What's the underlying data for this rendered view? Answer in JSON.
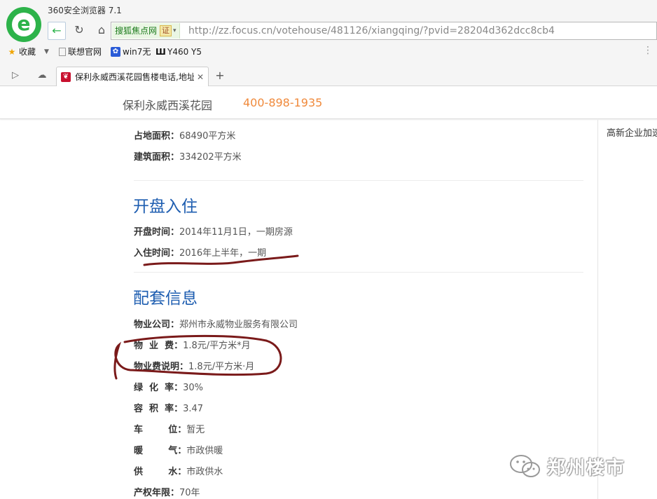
{
  "browser": {
    "title": "360安全浏览器 7.1",
    "site_badge": "搜狐焦点网",
    "cert_label": "证",
    "url": "http://zz.focus.cn/votehouse/481126/xiangqing/?pvid=28204d362dcc8cb4",
    "bookmarks": [
      {
        "label": "收藏",
        "icon": "star-icon"
      },
      {
        "label": "联想官网",
        "icon": "page-icon"
      },
      {
        "label": "win7无",
        "icon": "paw-icon"
      },
      {
        "label": "Y460 Y5",
        "icon": "app-icon"
      }
    ],
    "tab": {
      "title": "保利永威西溪花园售楼电话,地址",
      "favicon": "focus-favicon"
    }
  },
  "header": {
    "project_name": "保利永威西溪花园",
    "phone": "400-898-1935"
  },
  "sidebar": {
    "text": "高新企业加速"
  },
  "sections": {
    "basic": [
      {
        "key": "占地面积：",
        "value": "68490平方米"
      },
      {
        "key": "建筑面积：",
        "value": "334202平方米"
      }
    ],
    "opening": {
      "title": "开盘入住",
      "rows": [
        {
          "key": "开盘时间：",
          "value": "2014年11月1日，一期房源"
        },
        {
          "key": "入住时间：",
          "value": "2016年上半年，一期"
        }
      ]
    },
    "facilities": {
      "title": "配套信息",
      "rows": [
        {
          "key": "物业公司：",
          "value": "郑州市永威物业服务有限公司"
        },
        {
          "key": "物  业  费：",
          "value": "1.8元/平方米*月"
        },
        {
          "key": "物业费说明：",
          "value": "1.8元/平方米·月"
        },
        {
          "key": "绿  化  率：",
          "value": "30%"
        },
        {
          "key": "容  积  率：",
          "value": "3.47"
        },
        {
          "key": "车        位：",
          "value": "暂无"
        },
        {
          "key": "暖        气：",
          "value": "市政供暖"
        },
        {
          "key": "供        水：",
          "value": "市政供水"
        },
        {
          "key": "产权年限：",
          "value": "70年"
        }
      ]
    }
  },
  "watermark": {
    "text": "郑州楼市"
  },
  "colors": {
    "accent_blue": "#1d5db0",
    "phone_orange": "#f08a3c",
    "annotation_red": "#7a1a1a"
  }
}
